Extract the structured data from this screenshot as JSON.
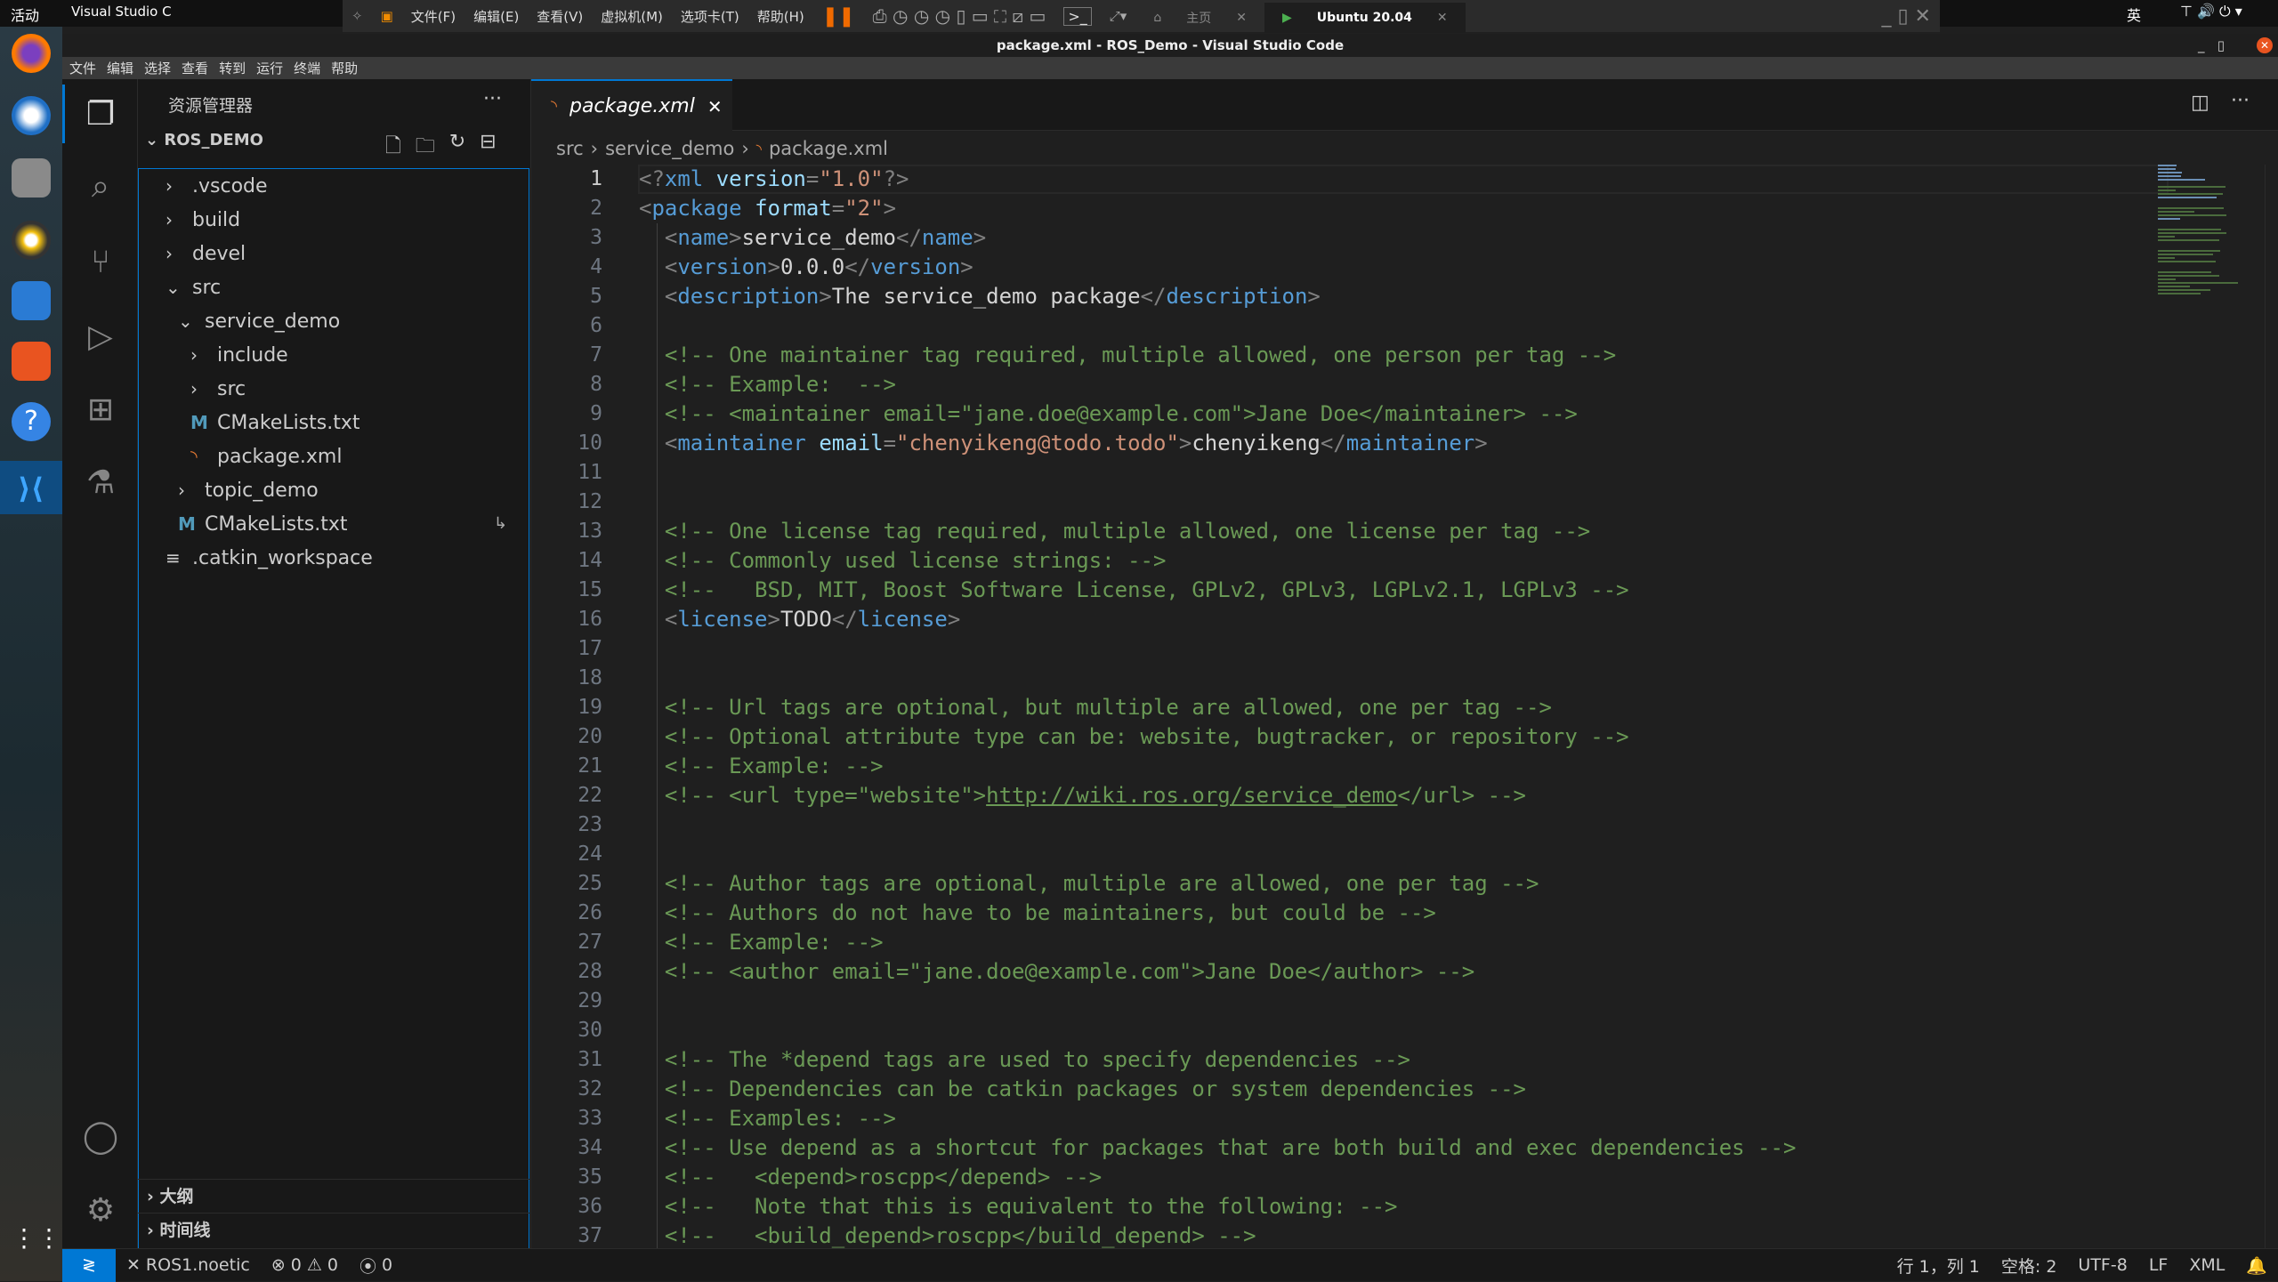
{
  "system": {
    "activities": "活动",
    "app_name": "Visual Studio C",
    "ime": "英",
    "colors": {
      "accent": "#0078d4",
      "close_red": "#e95420"
    }
  },
  "vmware": {
    "menu": [
      "文件(F)",
      "编辑(E)",
      "查看(V)",
      "虚拟机(M)",
      "选项卡(T)",
      "帮助(H)"
    ],
    "tabs": [
      {
        "label": "主页"
      },
      {
        "label": "Ubuntu 20.04"
      }
    ]
  },
  "window": {
    "title": "package.xml - ROS_Demo - Visual Studio Code"
  },
  "menubar": [
    "文件",
    "编辑",
    "选择",
    "查看",
    "转到",
    "运行",
    "终端",
    "帮助"
  ],
  "sidebar": {
    "title": "资源管理器",
    "workspace": "ROS_DEMO",
    "tree": [
      {
        "label": ".vscode",
        "depth": 0,
        "kind": "folder",
        "open": false
      },
      {
        "label": "build",
        "depth": 0,
        "kind": "folder",
        "open": false
      },
      {
        "label": "devel",
        "depth": 0,
        "kind": "folder",
        "open": false
      },
      {
        "label": "src",
        "depth": 0,
        "kind": "folder",
        "open": true
      },
      {
        "label": "service_demo",
        "depth": 1,
        "kind": "folder",
        "open": true
      },
      {
        "label": "include",
        "depth": 2,
        "kind": "folder",
        "open": false
      },
      {
        "label": "src",
        "depth": 2,
        "kind": "folder",
        "open": false
      },
      {
        "label": "CMakeLists.txt",
        "depth": 2,
        "kind": "cmake"
      },
      {
        "label": "package.xml",
        "depth": 2,
        "kind": "xml"
      },
      {
        "label": "topic_demo",
        "depth": 1,
        "kind": "folder",
        "open": false
      },
      {
        "label": "CMakeLists.txt",
        "depth": 1,
        "kind": "cmake"
      },
      {
        "label": ".catkin_workspace",
        "depth": 0,
        "kind": "text"
      }
    ],
    "outline": "大纲",
    "timeline": "时间线"
  },
  "editor": {
    "tab": "package.xml",
    "breadcrumb": [
      "src",
      "service_demo",
      "package.xml"
    ],
    "lines": [
      [
        [
          "p",
          "<?"
        ],
        [
          "t",
          "xml"
        ],
        [
          "x",
          " "
        ],
        [
          "a",
          "version"
        ],
        [
          "p",
          "="
        ],
        [
          "s",
          "\"1.0\""
        ],
        [
          "p",
          "?>"
        ]
      ],
      [
        [
          "p",
          "<"
        ],
        [
          "t",
          "package"
        ],
        [
          "x",
          " "
        ],
        [
          "a",
          "format"
        ],
        [
          "p",
          "="
        ],
        [
          "s",
          "\"2\""
        ],
        [
          "p",
          ">"
        ]
      ],
      [
        [
          "x",
          "  "
        ],
        [
          "p",
          "<"
        ],
        [
          "t",
          "name"
        ],
        [
          "p",
          ">"
        ],
        [
          "x",
          "service_demo"
        ],
        [
          "p",
          "</"
        ],
        [
          "t",
          "name"
        ],
        [
          "p",
          ">"
        ]
      ],
      [
        [
          "x",
          "  "
        ],
        [
          "p",
          "<"
        ],
        [
          "t",
          "version"
        ],
        [
          "p",
          ">"
        ],
        [
          "x",
          "0.0.0"
        ],
        [
          "p",
          "</"
        ],
        [
          "t",
          "version"
        ],
        [
          "p",
          ">"
        ]
      ],
      [
        [
          "x",
          "  "
        ],
        [
          "p",
          "<"
        ],
        [
          "t",
          "description"
        ],
        [
          "p",
          ">"
        ],
        [
          "x",
          "The service_demo package"
        ],
        [
          "p",
          "</"
        ],
        [
          "t",
          "description"
        ],
        [
          "p",
          ">"
        ]
      ],
      [],
      [
        [
          "c",
          "  <!-- One maintainer tag required, multiple allowed, one person per tag -->"
        ]
      ],
      [
        [
          "c",
          "  <!-- Example:  -->"
        ]
      ],
      [
        [
          "c",
          "  <!-- <maintainer email=\"jane.doe@example.com\">Jane Doe</maintainer> -->"
        ]
      ],
      [
        [
          "x",
          "  "
        ],
        [
          "p",
          "<"
        ],
        [
          "t",
          "maintainer"
        ],
        [
          "x",
          " "
        ],
        [
          "a",
          "email"
        ],
        [
          "p",
          "="
        ],
        [
          "s",
          "\"chenyikeng@todo.todo\""
        ],
        [
          "p",
          ">"
        ],
        [
          "x",
          "chenyikeng"
        ],
        [
          "p",
          "</"
        ],
        [
          "t",
          "maintainer"
        ],
        [
          "p",
          ">"
        ]
      ],
      [],
      [],
      [
        [
          "c",
          "  <!-- One license tag required, multiple allowed, one license per tag -->"
        ]
      ],
      [
        [
          "c",
          "  <!-- Commonly used license strings: -->"
        ]
      ],
      [
        [
          "c",
          "  <!--   BSD, MIT, Boost Software License, GPLv2, GPLv3, LGPLv2.1, LGPLv3 -->"
        ]
      ],
      [
        [
          "x",
          "  "
        ],
        [
          "p",
          "<"
        ],
        [
          "t",
          "license"
        ],
        [
          "p",
          ">"
        ],
        [
          "x",
          "TODO"
        ],
        [
          "p",
          "</"
        ],
        [
          "t",
          "license"
        ],
        [
          "p",
          ">"
        ]
      ],
      [],
      [],
      [
        [
          "c",
          "  <!-- Url tags are optional, but multiple are allowed, one per tag -->"
        ]
      ],
      [
        [
          "c",
          "  <!-- Optional attribute type can be: website, bugtracker, or repository -->"
        ]
      ],
      [
        [
          "c",
          "  <!-- Example: -->"
        ]
      ],
      [
        [
          "c",
          "  <!-- <url type=\"website\">"
        ],
        [
          "u",
          "http://wiki.ros.org/service_demo"
        ],
        [
          "c",
          "</url> -->"
        ]
      ],
      [],
      [],
      [
        [
          "c",
          "  <!-- Author tags are optional, multiple are allowed, one per tag -->"
        ]
      ],
      [
        [
          "c",
          "  <!-- Authors do not have to be maintainers, but could be -->"
        ]
      ],
      [
        [
          "c",
          "  <!-- Example: -->"
        ]
      ],
      [
        [
          "c",
          "  <!-- <author email=\"jane.doe@example.com\">Jane Doe</author> -->"
        ]
      ],
      [],
      [],
      [
        [
          "c",
          "  <!-- The *depend tags are used to specify dependencies -->"
        ]
      ],
      [
        [
          "c",
          "  <!-- Dependencies can be catkin packages or system dependencies -->"
        ]
      ],
      [
        [
          "c",
          "  <!-- Examples: -->"
        ]
      ],
      [
        [
          "c",
          "  <!-- Use depend as a shortcut for packages that are both build and exec dependencies -->"
        ]
      ],
      [
        [
          "c",
          "  <!--   <depend>roscpp</depend> -->"
        ]
      ],
      [
        [
          "c",
          "  <!--   Note that this is equivalent to the following: -->"
        ]
      ],
      [
        [
          "c",
          "  <!--   <build_depend>roscpp</build_depend> -->"
        ]
      ]
    ]
  },
  "status": {
    "remote": "ROS1.noetic",
    "errors": "0",
    "warnings": "0",
    "ports": "0",
    "position": "行 1，列 1",
    "indent": "空格: 2",
    "encoding": "UTF-8",
    "eol": "LF",
    "language": "XML"
  }
}
